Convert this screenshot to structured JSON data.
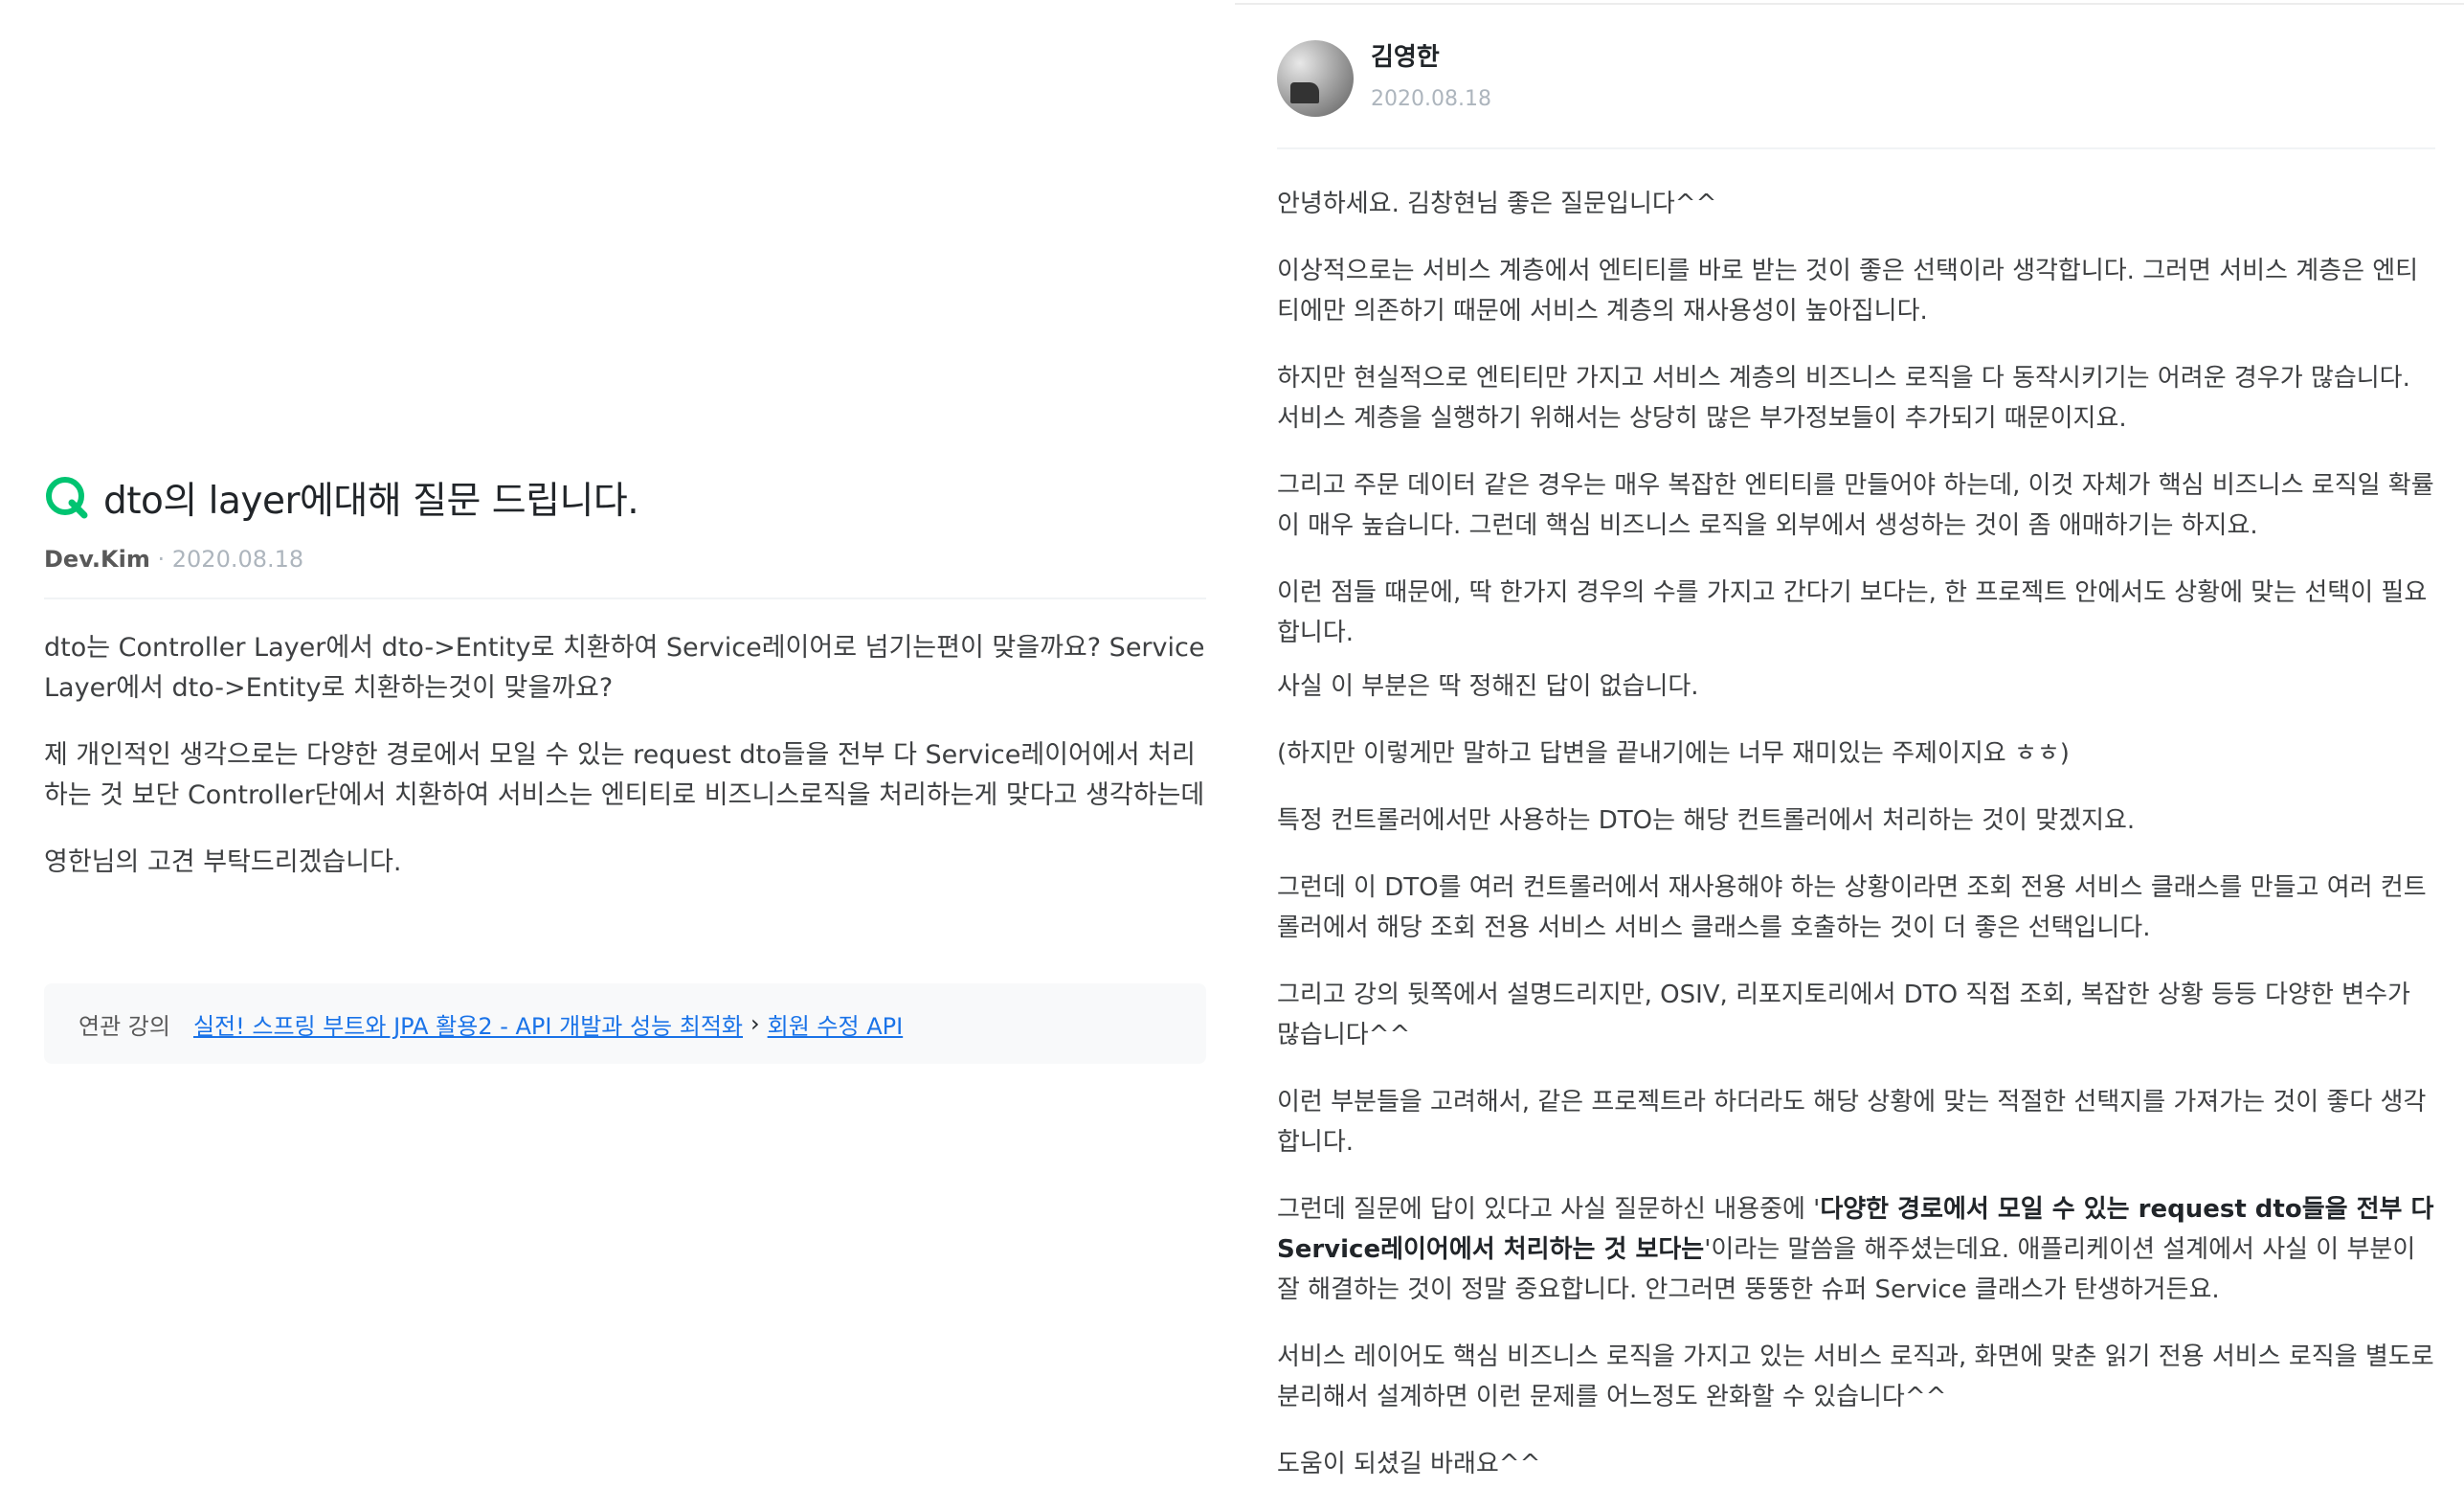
{
  "question": {
    "icon": "q-icon",
    "title": "dto의 layer에대해 질문 드립니다.",
    "author": "Dev.Kim",
    "separator": "·",
    "date": "2020.08.18",
    "paragraphs": [
      "dto는 Controller Layer에서 dto->Entity로 치환하여 Service레이어로 넘기는편이 맞을까요? Service Layer에서 dto->Entity로 치환하는것이 맞을까요?",
      "제 개인적인 생각으로는  다양한 경로에서 모일 수 있는 request dto들을 전부 다 Service레이어에서 처리하는 것 보단 Controller단에서 치환하여 서비스는 엔티티로 비즈니스로직을 처리하는게 맞다고 생각하는데",
      "영한님의 고견 부탁드리겠습니다."
    ],
    "related": {
      "label": "연관 강의",
      "course": "실전! 스프링 부트와 JPA 활용2 - API 개발과 성능 최적화",
      "separator": "›",
      "lesson": "회원 수정 API"
    }
  },
  "answer": {
    "author": "김영한",
    "date": "2020.08.18",
    "paragraphs": [
      "안녕하세요. 김창현님 좋은 질문입니다^^",
      "이상적으로는 서비스 계층에서 엔티티를 바로 받는 것이 좋은 선택이라 생각합니다. 그러면 서비스 계층은 엔티티에만 의존하기 때문에 서비스 계층의 재사용성이 높아집니다.",
      "하지만 현실적으로 엔티티만 가지고 서비스 계층의 비즈니스 로직을 다 동작시키기는 어려운 경우가 많습니다. 서비스 계층을 실행하기 위해서는 상당히 많은 부가정보들이 추가되기 때문이지요.",
      "그리고 주문 데이터 같은 경우는 매우 복잡한 엔티티를 만들어야 하는데, 이것 자체가 핵심 비즈니스 로직일 확률이 매우 높습니다. 그런데 핵심 비즈니스 로직을 외부에서 생성하는 것이 좀 애매하기는 하지요.",
      "이런 점들 때문에, 딱 한가지 경우의 수를 가지고 간다기 보다는, 한 프로젝트 안에서도 상황에 맞는 선택이 필요합니다.",
      "사실 이 부분은 딱 정해진 답이 없습니다.",
      "(하지만 이렇게만 말하고 답변을 끝내기에는 너무 재미있는 주제이지요 ㅎㅎ)",
      "특정 컨트롤러에서만 사용하는 DTO는 해당 컨트롤러에서 처리하는 것이 맞겠지요.",
      "그런데 이 DTO를 여러 컨트롤러에서 재사용해야 하는 상황이라면 조회 전용 서비스 클래스를 만들고 여러 컨트롤러에서 해당 조회 전용 서비스 서비스 클래스를 호출하는 것이 더 좋은 선택입니다.",
      "그리고 강의 뒷쪽에서 설명드리지만, OSIV, 리포지토리에서 DTO 직접 조회, 복잡한 상황 등등 다양한 변수가 많습니다^^",
      "이런 부분들을 고려해서, 같은 프로젝트라 하더라도 해당 상황에 맞는 적절한 선택지를 가져가는 것이 좋다 생각합니다."
    ],
    "mixed": {
      "before": "그런데 질문에 답이 있다고 사실 질문하신 내용중에 '",
      "bold": "다양한 경로에서 모일 수 있는 request dto들을 전부 다 Service레이어에서 처리하는 것 보다는",
      "after": "'이라는 말씀을 해주셨는데요. 애플리케이션 설계에서 사실 이 부분이 잘 해결하는 것이 정말 중요합니다. 안그러면 뚱뚱한 슈퍼 Service 클래스가 탄생하거든요."
    },
    "closing": [
      "서비스 레이어도 핵심 비즈니스 로직을 가지고 있는 서비스 로직과, 화면에 맞춘 읽기 전용 서비스 로직을 별도로 분리해서 설계하면 이런 문제를 어느정도 완화할 수 있습니다^^",
      "도움이 되셨길 바래요^^"
    ]
  }
}
